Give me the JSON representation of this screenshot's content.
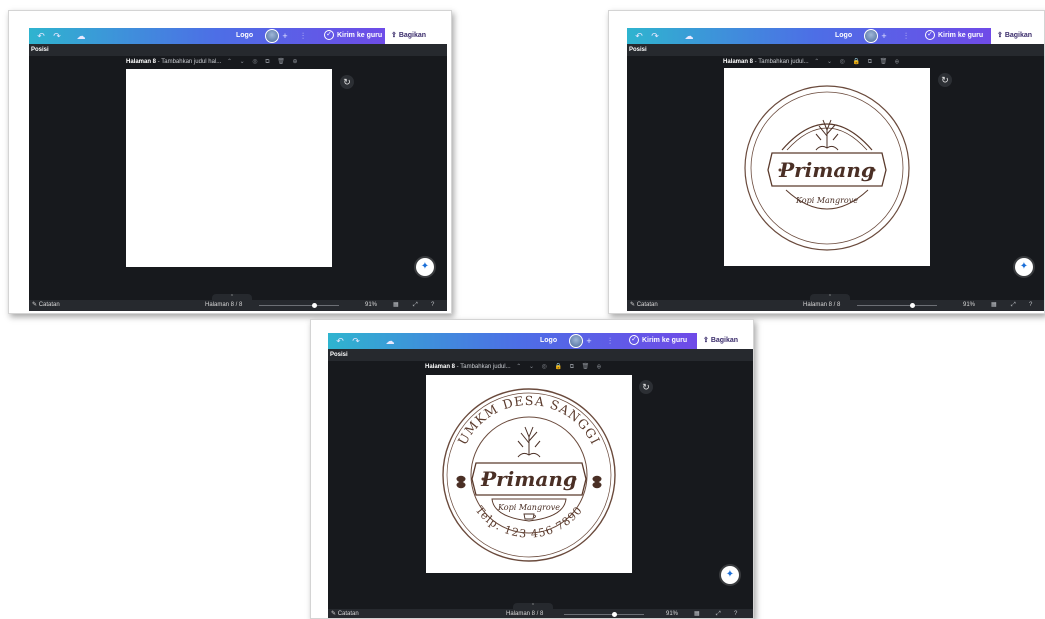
{
  "shots": [
    {
      "topbar": {
        "logo": "Logo",
        "send": "Kirim ke guru",
        "share": "Bagikan"
      },
      "position_label": "Posisi",
      "page_header": {
        "page": "Halaman 8",
        "title": "Tambahkan judul hal..."
      },
      "bottom": {
        "notes": "Catatan",
        "page_indicator": "Halaman 8 / 8",
        "zoom": "91%"
      }
    },
    {
      "topbar": {
        "logo": "Logo",
        "send": "Kirim ke guru",
        "share": "Bagikan"
      },
      "position_label": "Posisi",
      "page_header": {
        "page": "Halaman 8",
        "title": "Tambahkan judul..."
      },
      "bottom": {
        "notes": "Catatan",
        "page_indicator": "Halaman 8 / 8",
        "zoom": "91%"
      },
      "logo": {
        "brand": "Primang",
        "sub": "Kopi Mangrove"
      }
    },
    {
      "topbar": {
        "logo": "Logo",
        "send": "Kirim ke guru",
        "share": "Bagikan"
      },
      "position_label": "Posisi",
      "page_header": {
        "page": "Halaman 8",
        "title": "Tambahkan judul..."
      },
      "bottom": {
        "notes": "Catatan",
        "page_indicator": "Halaman 8 / 8",
        "zoom": "91%"
      },
      "logo": {
        "brand": "Primang",
        "sub": "Kopi Mangrove",
        "arc_top": "UMKM DESA SANGGI",
        "arc_bottom": "Telp. 123 456 7890"
      }
    }
  ],
  "colors": {
    "logo_brown": "#5a3a2c",
    "canvas_bg": "#17191d",
    "accent_purple": "#7a3fe8"
  }
}
